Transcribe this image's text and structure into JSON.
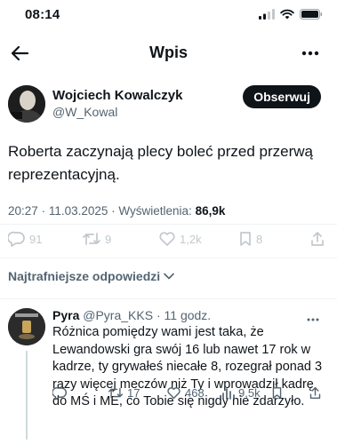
{
  "status_bar": {
    "time": "08:14"
  },
  "nav": {
    "title": "Wpis"
  },
  "tweet": {
    "author_name": "Wojciech Kowalczyk",
    "author_handle": "@W_Kowal",
    "follow_label": "Obserwuj",
    "text": "Roberta zaczynają plecy boleć przed przerwą reprezentacyjną.",
    "time": "20:27",
    "date": "11.03.2025",
    "views_label": "Wyświetlenia:",
    "views_count": "86,9k",
    "replies": "91",
    "retweets": "9",
    "likes": "1,2k",
    "bookmarks": "8",
    "sep": "·"
  },
  "sort": {
    "label": "Najtrafniejsze odpowiedzi"
  },
  "reply": {
    "name": "Pyra",
    "handle": "@Pyra_KKS",
    "dot": "·",
    "time": "11 godz.",
    "text": "Różnica pomiędzy wami jest taka, że Lewandowski gra swój 16 lub nawet 17 rok w kadrze, ty grywałeś niecałe 8, rozegrał ponad 3 razy więcej meczów niż Ty i wprowadził kadrę do MŚ i ME, co Tobie się nigdy nie zdarzyło.",
    "retweets": "17",
    "likes": "468",
    "views": "9,5k"
  }
}
